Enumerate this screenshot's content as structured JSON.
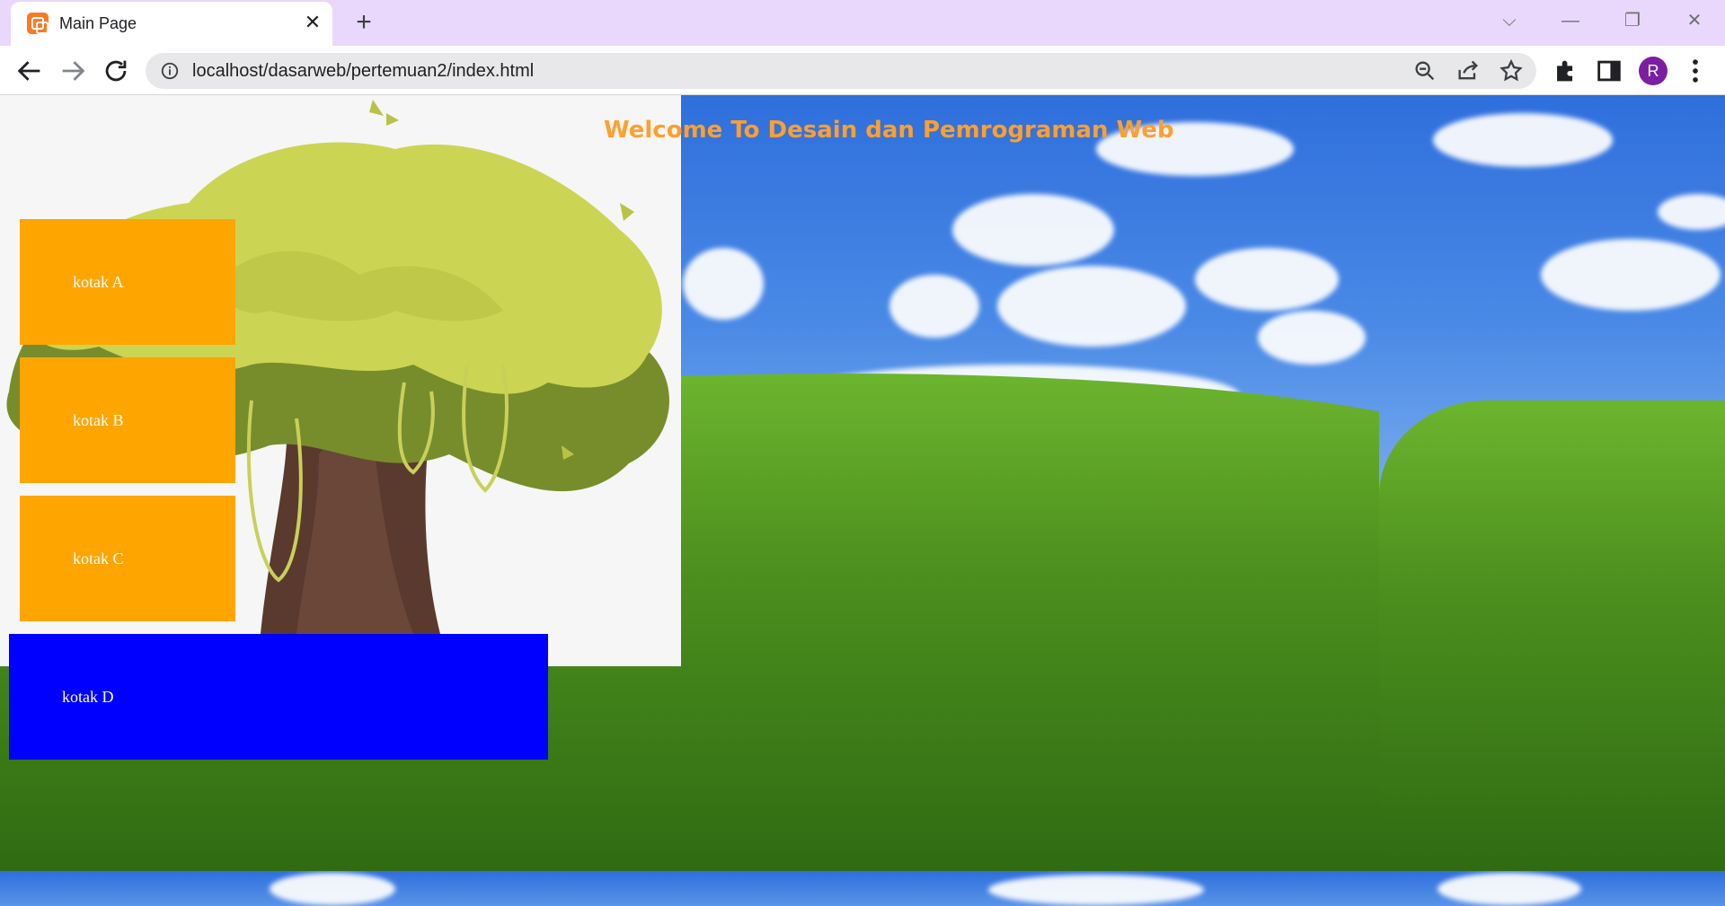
{
  "browser": {
    "tab_title": "Main Page",
    "url": "localhost/dasarweb/pertemuan2/index.html",
    "profile_initial": "R",
    "accent": "#e9d8fb",
    "avatar_color": "#7b1fa2"
  },
  "icons": {
    "favicon": "xampp-icon",
    "tab_close": "close-icon",
    "new_tab": "plus-icon",
    "back": "arrow-left-icon",
    "forward": "arrow-right-icon",
    "reload": "reload-icon",
    "site_info": "info-icon",
    "zoom": "zoom-out-icon",
    "share": "share-icon",
    "bookmark": "star-icon",
    "extensions": "puzzle-icon",
    "side_panel": "side-panel-icon",
    "menu": "kebab-menu-icon"
  },
  "page": {
    "heading": "Welcome To Desain dan Pemrograman Web",
    "heading_color": "#ff9f2e",
    "boxes": [
      {
        "label": "kotak A",
        "color": "#ffa500"
      },
      {
        "label": "kotak B",
        "color": "#ffa500"
      },
      {
        "label": "kotak C",
        "color": "#ffa500"
      },
      {
        "label": "kotak D",
        "color": "#0000ff"
      }
    ]
  }
}
